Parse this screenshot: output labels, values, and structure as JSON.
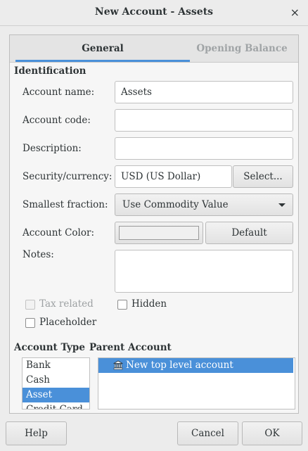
{
  "window": {
    "title": "New Account - Assets",
    "close_glyph": "×"
  },
  "tabs": [
    {
      "label": "General",
      "active": true
    },
    {
      "label": "Opening Balance",
      "active": false
    }
  ],
  "identification": {
    "heading": "Identification",
    "account_name": {
      "label": "Account name:",
      "value": "Assets"
    },
    "account_code": {
      "label": "Account code:",
      "value": ""
    },
    "description": {
      "label": "Description:",
      "value": ""
    },
    "security": {
      "label": "Security/currency:",
      "value": "USD (US Dollar)",
      "button": "Select..."
    },
    "smallest_fraction": {
      "label": "Smallest fraction:",
      "value": "Use Commodity Value"
    },
    "account_color": {
      "label": "Account Color:",
      "button": "Default",
      "swatch": "#f0f0f0"
    },
    "notes": {
      "label": "Notes:",
      "value": ""
    }
  },
  "checkboxes": {
    "tax_related": {
      "label": "Tax related",
      "checked": false,
      "enabled": false
    },
    "hidden": {
      "label": "Hidden",
      "checked": false,
      "enabled": true
    },
    "placeholder": {
      "label": "Placeholder",
      "checked": false,
      "enabled": true
    }
  },
  "account_type": {
    "heading": "Account Type",
    "items": [
      "Bank",
      "Cash",
      "Asset",
      "Credit Card"
    ],
    "selected": "Asset"
  },
  "parent_account": {
    "heading": "Parent Account",
    "items": [
      {
        "label": "New top level account",
        "icon": "bank-icon",
        "selected": true
      }
    ]
  },
  "footer": {
    "help": "Help",
    "cancel": "Cancel",
    "ok": "OK"
  },
  "colors": {
    "accent": "#4a90d9",
    "background": "#ececec",
    "disabled_text": "#a0a4a6"
  }
}
